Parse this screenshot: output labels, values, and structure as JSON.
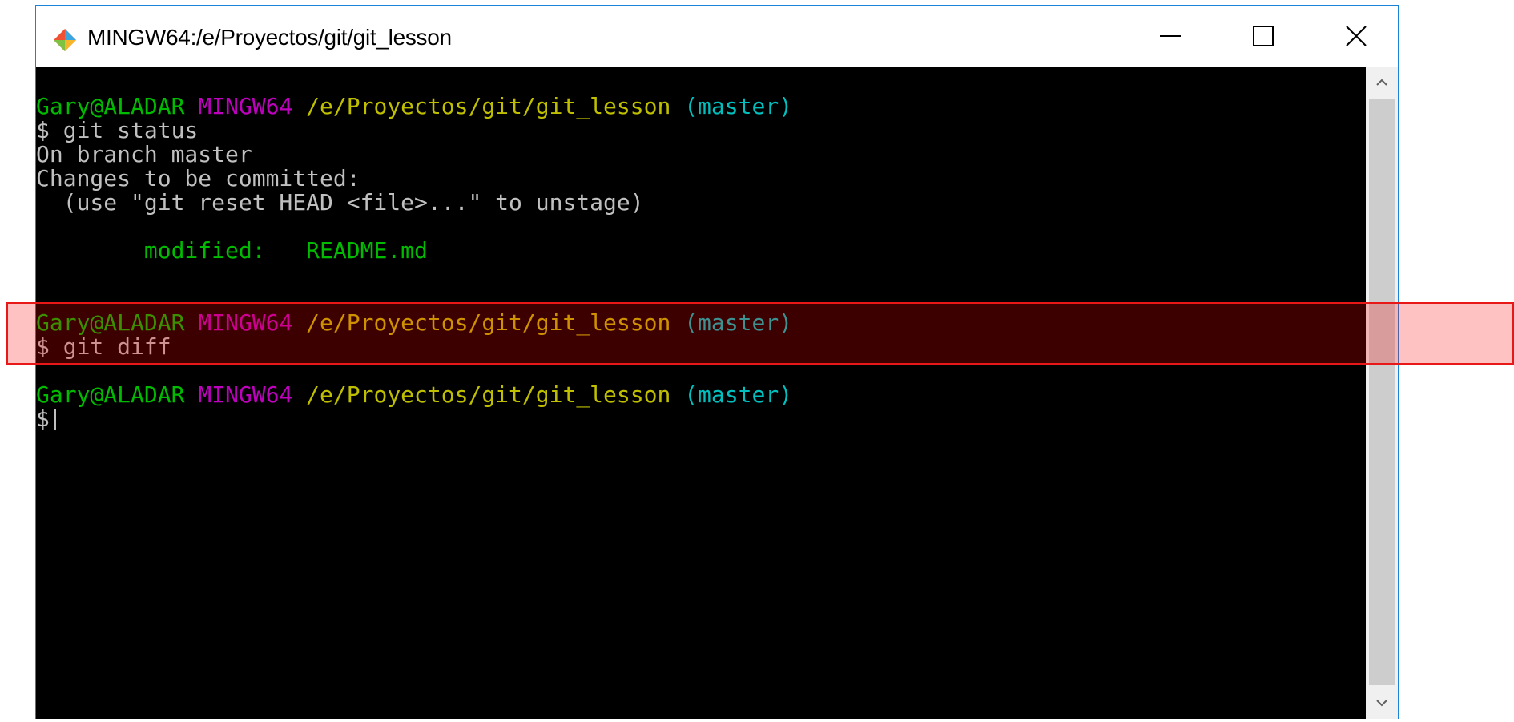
{
  "window": {
    "title": "MINGW64:/e/Proyectos/git/git_lesson",
    "icon": "git-bash-icon",
    "controls": {
      "minimize": "minimize-icon",
      "maximize": "maximize-icon",
      "close": "close-icon"
    }
  },
  "colors": {
    "user_host": "#00bb00",
    "shell": "#bf00bf",
    "path": "#bfbf00",
    "branch": "#00bfbf",
    "text": "#c0c0c0",
    "modified": "#00bb00",
    "highlight_border": "#e81818"
  },
  "terminal": {
    "prompt1": {
      "user_host": "Gary@ALADAR",
      "shell": "MINGW64",
      "path": "/e/Proyectos/git/git_lesson",
      "branch": "(master)"
    },
    "cmd1": "$ git status",
    "out1": "On branch master",
    "out2": "Changes to be committed:",
    "out3": "  (use \"git reset HEAD <file>...\" to unstage)",
    "out4_label": "        modified:",
    "out4_file": "   README.md",
    "prompt2": {
      "user_host": "Gary@ALADAR",
      "shell": "MINGW64",
      "path": "/e/Proyectos/git/git_lesson",
      "branch": "(master)"
    },
    "cmd2": "$ git diff",
    "prompt3": {
      "user_host": "Gary@ALADAR",
      "shell": "MINGW64",
      "path": "/e/Proyectos/git/git_lesson",
      "branch": "(master)"
    },
    "cmd3": "$"
  }
}
